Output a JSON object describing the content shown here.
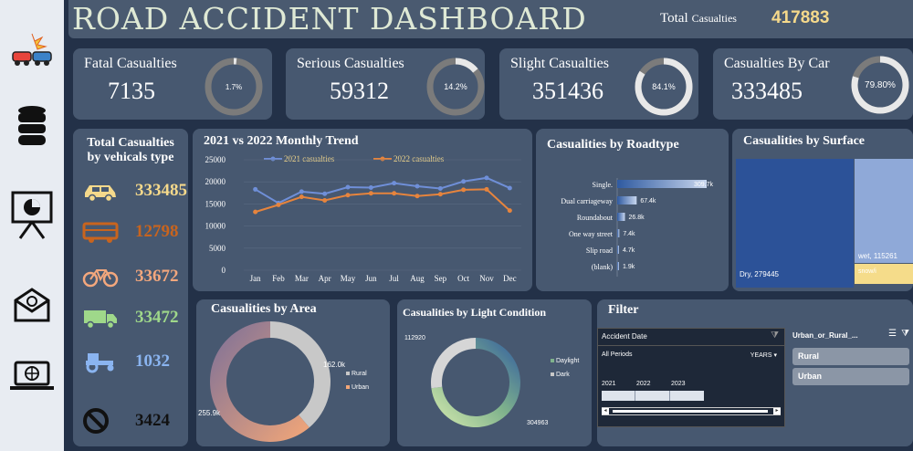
{
  "header": {
    "title": "ROAD ACCIDENT DASHBOARD",
    "total_label": "Total",
    "total_small": "Casualties",
    "total_value": "417883"
  },
  "sidebar": {
    "items": [
      "car-crash-icon",
      "database-icon",
      "presentation-chart-icon",
      "email-icon",
      "laptop-globe-icon"
    ]
  },
  "kpis": [
    {
      "title": "Fatal  Casualties",
      "value": "7135",
      "pct_label": "1.7%",
      "pct": 0.017
    },
    {
      "title": "Serious Casualties",
      "value": "59312",
      "pct_label": "14.2%",
      "pct": 0.142
    },
    {
      "title": "Slight Casualties",
      "value": "351436",
      "pct_label": "84.1%",
      "pct": 0.841
    },
    {
      "title": "Casualties By Car",
      "value": "333485",
      "pct_label": "79.80%",
      "pct": 0.798
    }
  ],
  "vehicles": {
    "title_line1": "Total Casualties",
    "title_line2": "by vehicals type",
    "items": [
      {
        "icon": "car-icon",
        "value": "333485",
        "color": "#f5d98b"
      },
      {
        "icon": "bus-icon",
        "value": "12798",
        "color": "#c8641e"
      },
      {
        "icon": "bicycle-icon",
        "value": "33672",
        "color": "#f3a77d"
      },
      {
        "icon": "truck-icon",
        "value": "33472",
        "color": "#9fd88a"
      },
      {
        "icon": "tractor-icon",
        "value": "1032",
        "color": "#8ab4f0"
      },
      {
        "icon": "no-entry-icon",
        "value": "3424",
        "color": "#111111"
      }
    ]
  },
  "trend": {
    "title": "2021 vs 2022 Monthly Trend",
    "legend_2021": "2021 casualties",
    "legend_2022": "2022 casualties",
    "y_ticks": [
      "25000",
      "20000",
      "15000",
      "10000",
      "5000",
      "0"
    ],
    "months": [
      "Jan",
      "Feb",
      "Mar",
      "Apr",
      "May",
      "Jun",
      "Jul",
      "Aug",
      "Sep",
      "Oct",
      "Nov",
      "Dec"
    ]
  },
  "roadtype": {
    "title": "Casualities by Roadtype",
    "items": [
      {
        "label": "Single.",
        "value": 309.7,
        "value_label": "309.7k"
      },
      {
        "label": "Dual carriageway",
        "value": 67.4,
        "value_label": "67.4k"
      },
      {
        "label": "Roundabout",
        "value": 26.8,
        "value_label": "26.8k"
      },
      {
        "label": "One way street",
        "value": 7.4,
        "value_label": "7.4k"
      },
      {
        "label": "Slip road",
        "value": 4.7,
        "value_label": "4.7k"
      },
      {
        "label": "(blank)",
        "value": 1.9,
        "value_label": "1.9k"
      }
    ]
  },
  "surface": {
    "title": "Casualities by Surface",
    "dry_label": "Dry, 279445",
    "wet_label": "wet, 115261",
    "snow_label": "snow/i"
  },
  "area": {
    "title": "Casualities by Area",
    "rural_value": "162.0k",
    "urban_value": "255.9k",
    "legend_rural": "Rural",
    "legend_urban": "Urban"
  },
  "light": {
    "title": "Casualities by Light Condition",
    "dark_value": "112920",
    "daylight_value": "304963",
    "legend_daylight": "Daylight",
    "legend_dark": "Dark"
  },
  "filter": {
    "title": "Filter",
    "slicer_title": "Accident Date",
    "periods": "All Periods",
    "years_label": "YEARS",
    "years": [
      "2021",
      "2022",
      "2023"
    ],
    "area_slicer_title": "Urban_or_Rural_...",
    "area_options": [
      "Rural",
      "Urban"
    ]
  },
  "chart_data": [
    {
      "type": "line",
      "title": "2021 vs 2022 Monthly Trend",
      "categories": [
        "Jan",
        "Feb",
        "Mar",
        "Apr",
        "May",
        "Jun",
        "Jul",
        "Aug",
        "Sep",
        "Oct",
        "Nov",
        "Dec"
      ],
      "ylim": [
        0,
        25000
      ],
      "series": [
        {
          "name": "2021 casualties",
          "color": "#6f8fd8",
          "values": [
            18300,
            15200,
            17800,
            17300,
            18800,
            18700,
            19700,
            19000,
            18500,
            20100,
            20900,
            18600
          ]
        },
        {
          "name": "2022 casualties",
          "color": "#e6843d",
          "values": [
            13200,
            14800,
            16600,
            15800,
            17000,
            17400,
            17400,
            16800,
            17200,
            18200,
            18300,
            13500
          ]
        }
      ]
    },
    {
      "type": "bar",
      "title": "Casualities by Roadtype",
      "categories": [
        "Single.",
        "Dual carriageway",
        "Roundabout",
        "One way street",
        "Slip road",
        "(blank)"
      ],
      "values": [
        309.7,
        67.4,
        26.8,
        7.4,
        4.7,
        1.9
      ]
    },
    {
      "type": "pie",
      "title": "Casualities by Area",
      "categories": [
        "Rural",
        "Urban"
      ],
      "values": [
        162.0,
        255.9
      ]
    },
    {
      "type": "pie",
      "title": "Casualities by Light Condition",
      "categories": [
        "Daylight",
        "Dark"
      ],
      "values": [
        304963,
        112920
      ]
    }
  ]
}
